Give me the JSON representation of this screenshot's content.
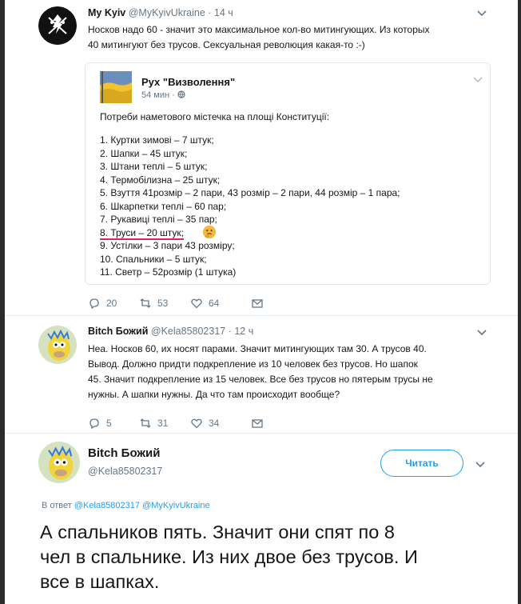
{
  "colors": {
    "accent": "#1da1f2",
    "muted": "#657786",
    "underline": "#e0245e"
  },
  "tweet1": {
    "name": "My Kyiv",
    "handle": "@MyKyivUkraine",
    "time": "· 14 ч",
    "text_line1": "Носков надо 60 - значит это максимальное кол-во митингующих. Из которых",
    "text_line2": "40 митингуют без трусов. Сексуальная революция какая-то :-)",
    "quote": {
      "name": "Рух \"Визволення\"",
      "time": "54 мин ·",
      "intro": "Потреби наметового містечка на площі Конституції:",
      "items": [
        "1. Куртки зимові – 7 штук;",
        "2. Шапки – 45 штук;",
        "3. Штани теплі – 5 штук;",
        "4. Термобілизна – 25 штук;",
        "5. Взуття 41розмір – 2 пари, 43 розмір – 2 пари, 44 розмір – 1 пара;",
        "6. Шкарпетки теплі – 60 пар;",
        "7. Рукавиці теплі – 35 пар;",
        "8. Труси – 20 штук;",
        "9. Устілки – 3 пари 43 розміру;",
        "10. Спальники – 5 штук;",
        "11. Светр – 52розмір (1 штука)"
      ]
    },
    "actions": {
      "replies": "20",
      "retweets": "53",
      "likes": "64"
    }
  },
  "tweet2": {
    "name": "Bitch Божий",
    "handle": "@Kela85802317",
    "time": "· 12 ч",
    "lines": [
      "Неа. Носков 60, их носят парами. Значит митингующих там 30. А трусов 40.",
      "Вывод. Должно придти подкрепление из 10 человек без трусов. Но шапок",
      "45. Значит подкрепление из 15 человек. Все без трусов но пятерым трусы не",
      "нужны. А шапки нужны. Да что там происходит вообще?"
    ],
    "actions": {
      "replies": "5",
      "retweets": "31",
      "likes": "34"
    }
  },
  "tweet3": {
    "name": "Bitch Божий",
    "handle": "@Kela85802317",
    "follow_label": "Читать",
    "reply_prefix": "В ответ",
    "reply_to1": "@Kela85802317",
    "reply_to2": "@MyKyivUkraine",
    "lines": [
      "А спальников пять. Значит они спят по 8",
      "чел в спальнике. Из них двое без трусов. И",
      "все в шапках."
    ]
  }
}
